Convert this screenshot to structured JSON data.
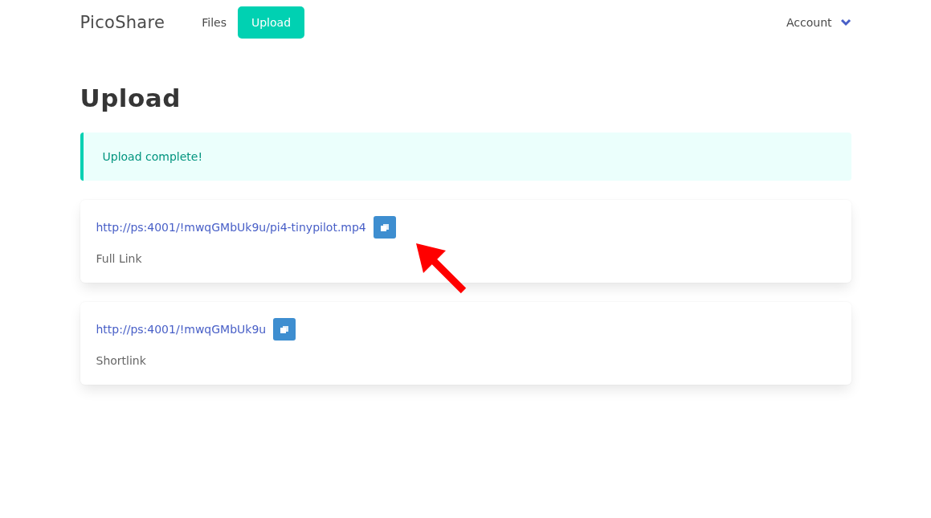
{
  "navbar": {
    "brand": "PicoShare",
    "items": [
      {
        "label": "Files",
        "selected": false
      },
      {
        "label": "Upload",
        "selected": true
      }
    ],
    "account": "Account"
  },
  "page": {
    "title": "Upload"
  },
  "notification": {
    "message": "Upload complete!"
  },
  "links": [
    {
      "url": "http://ps:4001/!mwqGMbUk9u/pi4-tinypilot.mp4",
      "label": "Full Link",
      "highlighted": true
    },
    {
      "url": "http://ps:4001/!mwqGMbUk9u",
      "label": "Shortlink",
      "highlighted": false
    }
  ]
}
